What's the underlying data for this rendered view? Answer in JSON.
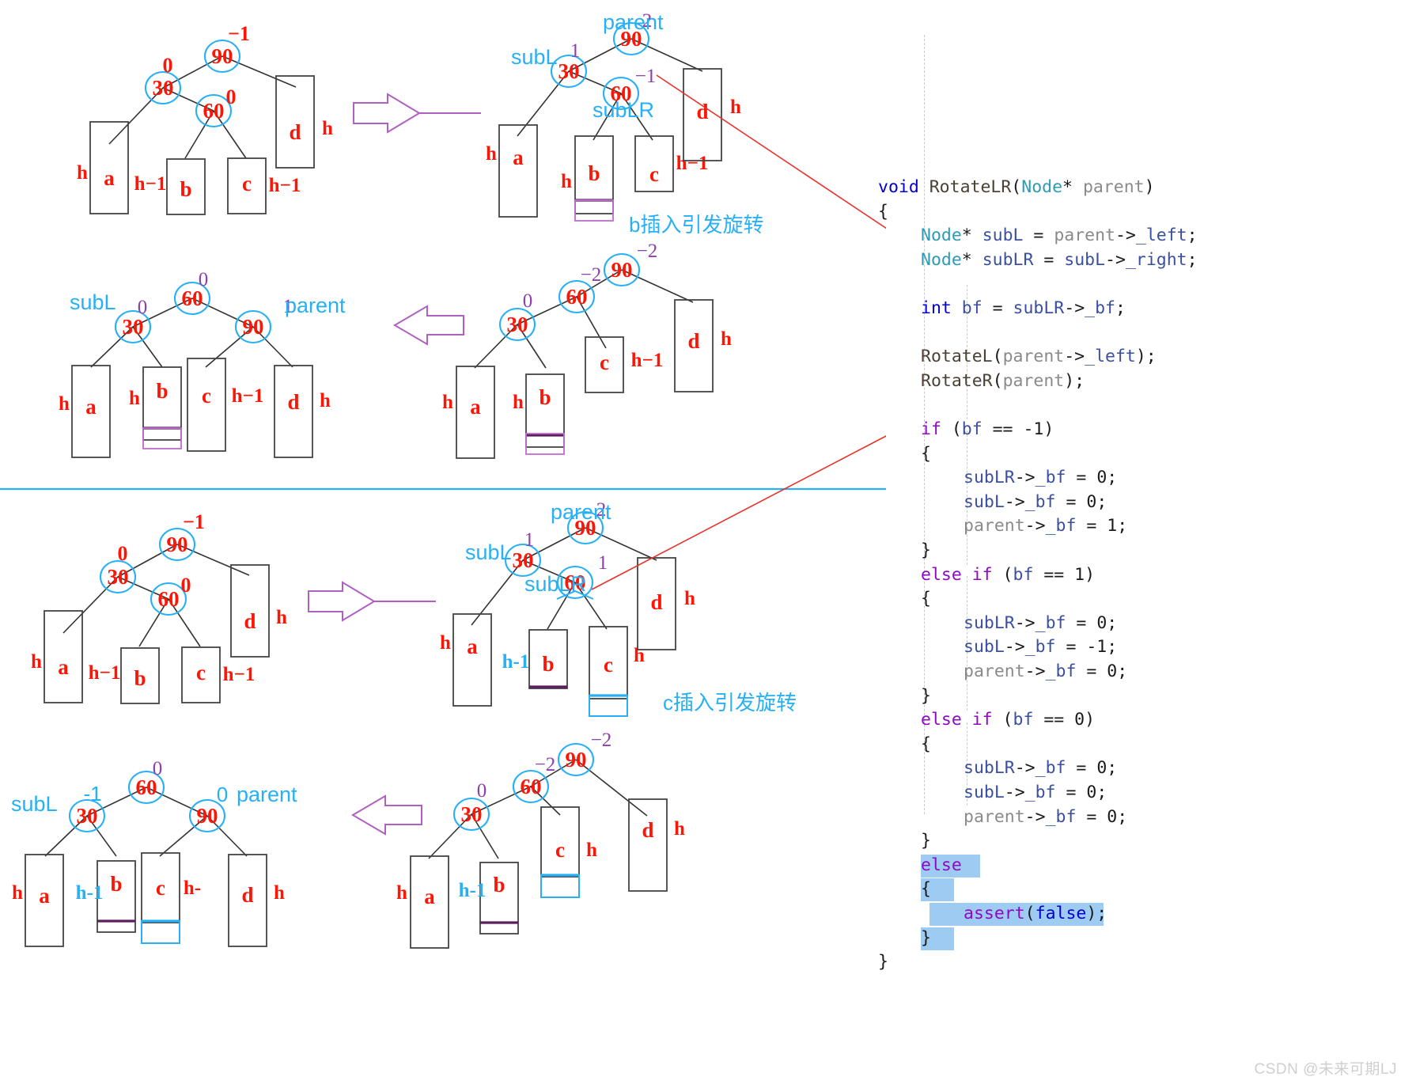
{
  "watermark": "CSDN @未来可期LJ",
  "code": {
    "lines": [
      {
        "indent": 0,
        "tokens": [
          {
            "t": "void",
            "c": "kw2"
          },
          {
            "t": " "
          },
          {
            "t": "RotateLR",
            "c": "fn"
          },
          {
            "t": "(",
            "c": "pun"
          },
          {
            "t": "Node",
            "c": "typ"
          },
          {
            "t": "*",
            "c": "pun"
          },
          {
            "t": " "
          },
          {
            "t": "parent",
            "c": "par"
          },
          {
            "t": ")",
            "c": "pun"
          }
        ]
      },
      {
        "indent": 0,
        "tokens": [
          {
            "t": "{",
            "c": "pun"
          }
        ]
      },
      {
        "indent": 1,
        "tokens": [
          {
            "t": "Node",
            "c": "typ"
          },
          {
            "t": "*",
            "c": "pun"
          },
          {
            "t": " "
          },
          {
            "t": "subL",
            "c": "var"
          },
          {
            "t": " = ",
            "c": "pun"
          },
          {
            "t": "parent",
            "c": "par"
          },
          {
            "t": "->",
            "c": "pun"
          },
          {
            "t": "_left",
            "c": "var"
          },
          {
            "t": ";",
            "c": "pun"
          }
        ]
      },
      {
        "indent": 1,
        "tokens": [
          {
            "t": "Node",
            "c": "typ"
          },
          {
            "t": "*",
            "c": "pun"
          },
          {
            "t": " "
          },
          {
            "t": "subLR",
            "c": "var"
          },
          {
            "t": " = ",
            "c": "pun"
          },
          {
            "t": "subL",
            "c": "var"
          },
          {
            "t": "->",
            "c": "pun"
          },
          {
            "t": "_right",
            "c": "var"
          },
          {
            "t": ";",
            "c": "pun"
          }
        ]
      },
      {
        "indent": 0,
        "tokens": []
      },
      {
        "indent": 1,
        "tokens": [
          {
            "t": "int",
            "c": "kw2"
          },
          {
            "t": " "
          },
          {
            "t": "bf",
            "c": "var"
          },
          {
            "t": " = ",
            "c": "pun"
          },
          {
            "t": "subLR",
            "c": "var"
          },
          {
            "t": "->",
            "c": "pun"
          },
          {
            "t": "_bf",
            "c": "var"
          },
          {
            "t": ";",
            "c": "pun"
          }
        ]
      },
      {
        "indent": 0,
        "tokens": []
      },
      {
        "indent": 1,
        "tokens": [
          {
            "t": "RotateL",
            "c": "fn"
          },
          {
            "t": "(",
            "c": "pun"
          },
          {
            "t": "parent",
            "c": "par"
          },
          {
            "t": "->",
            "c": "pun"
          },
          {
            "t": "_left",
            "c": "var"
          },
          {
            "t": ");",
            "c": "pun"
          }
        ]
      },
      {
        "indent": 1,
        "tokens": [
          {
            "t": "RotateR",
            "c": "fn"
          },
          {
            "t": "(",
            "c": "pun"
          },
          {
            "t": "parent",
            "c": "par"
          },
          {
            "t": ");",
            "c": "pun"
          }
        ]
      },
      {
        "indent": 0,
        "tokens": []
      },
      {
        "indent": 1,
        "tokens": [
          {
            "t": "if",
            "c": "kw"
          },
          {
            "t": " (",
            "c": "pun"
          },
          {
            "t": "bf",
            "c": "var"
          },
          {
            "t": " == ",
            "c": "pun"
          },
          {
            "t": "-1",
            "c": "num"
          },
          {
            "t": ")",
            "c": "pun"
          }
        ]
      },
      {
        "indent": 1,
        "tokens": [
          {
            "t": "{",
            "c": "pun"
          }
        ]
      },
      {
        "indent": 2,
        "tokens": [
          {
            "t": "subLR",
            "c": "var"
          },
          {
            "t": "->",
            "c": "pun"
          },
          {
            "t": "_bf",
            "c": "var"
          },
          {
            "t": " = ",
            "c": "pun"
          },
          {
            "t": "0",
            "c": "num"
          },
          {
            "t": ";",
            "c": "pun"
          }
        ]
      },
      {
        "indent": 2,
        "tokens": [
          {
            "t": "subL",
            "c": "var"
          },
          {
            "t": "->",
            "c": "pun"
          },
          {
            "t": "_bf",
            "c": "var"
          },
          {
            "t": " = ",
            "c": "pun"
          },
          {
            "t": "0",
            "c": "num"
          },
          {
            "t": ";",
            "c": "pun"
          }
        ]
      },
      {
        "indent": 2,
        "tokens": [
          {
            "t": "parent",
            "c": "par"
          },
          {
            "t": "->",
            "c": "pun"
          },
          {
            "t": "_bf",
            "c": "var"
          },
          {
            "t": " = ",
            "c": "pun"
          },
          {
            "t": "1",
            "c": "num"
          },
          {
            "t": ";",
            "c": "pun"
          }
        ]
      },
      {
        "indent": 1,
        "tokens": [
          {
            "t": "}",
            "c": "pun"
          }
        ]
      },
      {
        "indent": 1,
        "tokens": [
          {
            "t": "else if",
            "c": "kw"
          },
          {
            "t": " (",
            "c": "pun"
          },
          {
            "t": "bf",
            "c": "var"
          },
          {
            "t": " == ",
            "c": "pun"
          },
          {
            "t": "1",
            "c": "num"
          },
          {
            "t": ")",
            "c": "pun"
          }
        ]
      },
      {
        "indent": 1,
        "tokens": [
          {
            "t": "{",
            "c": "pun"
          }
        ]
      },
      {
        "indent": 2,
        "tokens": [
          {
            "t": "subLR",
            "c": "var"
          },
          {
            "t": "->",
            "c": "pun"
          },
          {
            "t": "_bf",
            "c": "var"
          },
          {
            "t": " = ",
            "c": "pun"
          },
          {
            "t": "0",
            "c": "num"
          },
          {
            "t": ";",
            "c": "pun"
          }
        ]
      },
      {
        "indent": 2,
        "tokens": [
          {
            "t": "subL",
            "c": "var"
          },
          {
            "t": "->",
            "c": "pun"
          },
          {
            "t": "_bf",
            "c": "var"
          },
          {
            "t": " = ",
            "c": "pun"
          },
          {
            "t": "-1",
            "c": "num"
          },
          {
            "t": ";",
            "c": "pun"
          }
        ]
      },
      {
        "indent": 2,
        "tokens": [
          {
            "t": "parent",
            "c": "par"
          },
          {
            "t": "->",
            "c": "pun"
          },
          {
            "t": "_bf",
            "c": "var"
          },
          {
            "t": " = ",
            "c": "pun"
          },
          {
            "t": "0",
            "c": "num"
          },
          {
            "t": ";",
            "c": "pun"
          }
        ]
      },
      {
        "indent": 1,
        "tokens": [
          {
            "t": "}",
            "c": "pun"
          }
        ]
      },
      {
        "indent": 1,
        "tokens": [
          {
            "t": "else if",
            "c": "kw"
          },
          {
            "t": " (",
            "c": "pun"
          },
          {
            "t": "bf",
            "c": "var"
          },
          {
            "t": " == ",
            "c": "pun"
          },
          {
            "t": "0",
            "c": "num"
          },
          {
            "t": ")",
            "c": "pun"
          }
        ]
      },
      {
        "indent": 1,
        "tokens": [
          {
            "t": "{",
            "c": "pun"
          }
        ]
      },
      {
        "indent": 2,
        "tokens": [
          {
            "t": "subLR",
            "c": "var"
          },
          {
            "t": "->",
            "c": "pun"
          },
          {
            "t": "_bf",
            "c": "var"
          },
          {
            "t": " = ",
            "c": "pun"
          },
          {
            "t": "0",
            "c": "num"
          },
          {
            "t": ";",
            "c": "pun"
          }
        ]
      },
      {
        "indent": 2,
        "tokens": [
          {
            "t": "subL",
            "c": "var"
          },
          {
            "t": "->",
            "c": "pun"
          },
          {
            "t": "_bf",
            "c": "var"
          },
          {
            "t": " = ",
            "c": "pun"
          },
          {
            "t": "0",
            "c": "num"
          },
          {
            "t": ";",
            "c": "pun"
          }
        ]
      },
      {
        "indent": 2,
        "tokens": [
          {
            "t": "parent",
            "c": "par"
          },
          {
            "t": "->",
            "c": "pun"
          },
          {
            "t": "_bf",
            "c": "var"
          },
          {
            "t": " = ",
            "c": "pun"
          },
          {
            "t": "0",
            "c": "num"
          },
          {
            "t": ";",
            "c": "pun"
          }
        ]
      },
      {
        "indent": 1,
        "tokens": [
          {
            "t": "}",
            "c": "pun"
          }
        ]
      },
      {
        "indent": 1,
        "sel": true,
        "selw": 75,
        "tokens": [
          {
            "t": "else",
            "c": "kw"
          }
        ]
      },
      {
        "indent": 1,
        "sel": true,
        "selw": 42,
        "tokens": [
          {
            "t": "{",
            "c": "pun"
          }
        ]
      },
      {
        "indent": 2,
        "sel": true,
        "selw": 220,
        "seloff": -43,
        "tokens": [
          {
            "t": "assert",
            "c": "kw"
          },
          {
            "t": "(",
            "c": "pun"
          },
          {
            "t": "false",
            "c": "kw2"
          },
          {
            "t": ");",
            "c": "pun"
          }
        ]
      },
      {
        "indent": 1,
        "sel": true,
        "selw": 42,
        "tokens": [
          {
            "t": "}",
            "c": "pun"
          }
        ]
      },
      {
        "indent": 0,
        "tokens": [
          {
            "t": "}",
            "c": "pun"
          }
        ]
      }
    ]
  },
  "annotations": {
    "divider_color": "#27b0f5",
    "arrow_color": "#b060c0",
    "node_stroke": "#27b0f5",
    "node_text": "#fd1505",
    "bf_color": "#8f3fa8",
    "label_color": "#27b0f5",
    "caption_b": "b插入引发旋转",
    "caption_c": "c插入引发旋转"
  },
  "trees": {
    "t1": {
      "name": "initial-tree-b-case",
      "nodes": [
        {
          "key": "90",
          "bf": "-1",
          "bf_color": "red"
        },
        {
          "key": "30",
          "bf": "0",
          "bf_color": "red"
        },
        {
          "key": "60",
          "bf": "0",
          "bf_color": "red"
        }
      ],
      "subtrees": [
        {
          "name": "a",
          "height": "h"
        },
        {
          "name": "b",
          "height": "h−1"
        },
        {
          "name": "c",
          "height": "h−1"
        },
        {
          "name": "d",
          "height": "h"
        }
      ]
    },
    "t2": {
      "name": "tree-after-b-insert",
      "labels": [
        "parent",
        "subL",
        "subLR"
      ],
      "nodes": [
        {
          "key": "90",
          "bf": "2"
        },
        {
          "key": "30",
          "bf": "1"
        },
        {
          "key": "60",
          "bf": "-1"
        }
      ],
      "subtrees": [
        {
          "name": "a",
          "height": "h"
        },
        {
          "name": "b",
          "height": "h"
        },
        {
          "name": "c",
          "height": "h−1"
        },
        {
          "name": "d",
          "height": "h−1"
        }
      ]
    },
    "t3": {
      "name": "tree-before-rotation-b",
      "nodes": [
        {
          "key": "90",
          "bf": "-2"
        },
        {
          "key": "60",
          "bf": "-2"
        },
        {
          "key": "30",
          "bf": "0"
        }
      ],
      "subtrees": [
        {
          "name": "a",
          "height": "h"
        },
        {
          "name": "b",
          "height": "h"
        },
        {
          "name": "c",
          "height": "h−1"
        },
        {
          "name": "d",
          "height": "h"
        }
      ]
    },
    "t4": {
      "name": "tree-after-rotation-b",
      "labels": [
        "subL",
        "parent"
      ],
      "nodes": [
        {
          "key": "60",
          "bf": "0"
        },
        {
          "key": "30",
          "bf": "0"
        },
        {
          "key": "90",
          "bf": "1"
        }
      ],
      "subtrees": [
        {
          "name": "a",
          "height": "h"
        },
        {
          "name": "b",
          "height": "h"
        },
        {
          "name": "c",
          "height": "h−1"
        },
        {
          "name": "d",
          "height": "h"
        }
      ]
    },
    "t5": {
      "name": "initial-tree-c-case",
      "nodes": [
        {
          "key": "90",
          "bf": "-1"
        },
        {
          "key": "30",
          "bf": "0"
        },
        {
          "key": "60",
          "bf": "0"
        }
      ],
      "subtrees": [
        {
          "name": "a",
          "height": "h"
        },
        {
          "name": "b",
          "height": "h−1"
        },
        {
          "name": "c",
          "height": "h−1"
        },
        {
          "name": "d",
          "height": "h"
        }
      ]
    },
    "t6": {
      "name": "tree-after-c-insert",
      "labels": [
        "parent",
        "subL",
        "subLR"
      ],
      "nodes": [
        {
          "key": "90",
          "bf": "2"
        },
        {
          "key": "30",
          "bf": "1"
        },
        {
          "key": "60",
          "bf": "1"
        }
      ],
      "subtrees": [
        {
          "name": "a",
          "height": "h"
        },
        {
          "name": "b",
          "height": "h-1"
        },
        {
          "name": "c",
          "height": "h"
        },
        {
          "name": "d",
          "height": "h"
        }
      ]
    },
    "t7": {
      "name": "tree-before-rotation-c",
      "nodes": [
        {
          "key": "90",
          "bf": "-2"
        },
        {
          "key": "60",
          "bf": "-2"
        },
        {
          "key": "30",
          "bf": "0"
        }
      ],
      "subtrees": [
        {
          "name": "a",
          "height": "h"
        },
        {
          "name": "b",
          "height": "h-1"
        },
        {
          "name": "c",
          "height": "h"
        },
        {
          "name": "d",
          "height": "h"
        }
      ]
    },
    "t8": {
      "name": "tree-after-rotation-c",
      "labels": [
        "subL",
        "parent"
      ],
      "nodes": [
        {
          "key": "60",
          "bf": "0"
        },
        {
          "key": "30",
          "bf": "-1"
        },
        {
          "key": "90",
          "bf": "0"
        }
      ],
      "subtrees": [
        {
          "name": "a",
          "height": "h"
        },
        {
          "name": "b",
          "height": "h-1"
        },
        {
          "name": "c",
          "height": "h"
        },
        {
          "name": "d",
          "height": "h"
        }
      ]
    }
  }
}
